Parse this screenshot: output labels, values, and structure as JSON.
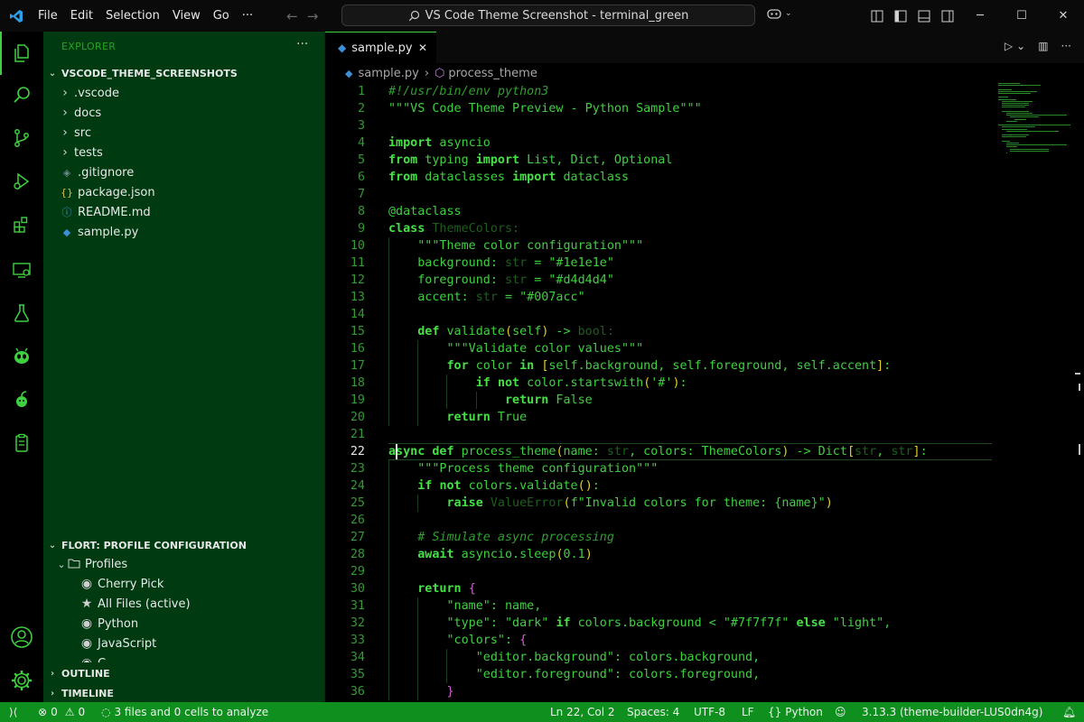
{
  "titlebar": {
    "menus": [
      "File",
      "Edit",
      "Selection",
      "View",
      "Go",
      "···"
    ],
    "command_center": "VS Code Theme Screenshot - terminal_green"
  },
  "explorer": {
    "header": "EXPLORER",
    "more": "···",
    "root": "VSCODE_THEME_SCREENSHOTS",
    "items": [
      {
        "label": ".vscode",
        "kind": "folder"
      },
      {
        "label": "docs",
        "kind": "folder"
      },
      {
        "label": "src",
        "kind": "folder"
      },
      {
        "label": "tests",
        "kind": "folder"
      },
      {
        "label": ".gitignore",
        "kind": "gitignore"
      },
      {
        "label": "package.json",
        "kind": "json"
      },
      {
        "label": "README.md",
        "kind": "info"
      },
      {
        "label": "sample.py",
        "kind": "python"
      }
    ]
  },
  "profiles": {
    "title": "FLORT: PROFILE CONFIGURATION",
    "group": "Profiles",
    "items": [
      {
        "label": "Cherry Pick",
        "icon": "account-icon"
      },
      {
        "label": "All Files (active)",
        "icon": "star-icon"
      },
      {
        "label": "Python",
        "icon": "account-icon"
      },
      {
        "label": "JavaScript",
        "icon": "account-icon"
      },
      {
        "label": "C...",
        "icon": "account-icon"
      }
    ]
  },
  "outline_title": "OUTLINE",
  "timeline_title": "TIMELINE",
  "tab": {
    "label": "sample.py",
    "close": "✕"
  },
  "breadcrumb": {
    "file": "sample.py",
    "symbol": "process_theme"
  },
  "cursor_line": 22,
  "code_lines": [
    "#!/usr/bin/env python3",
    "\"\"\"VS Code Theme Preview - Python Sample\"\"\"",
    "",
    "import asyncio",
    "from typing import List, Dict, Optional",
    "from dataclasses import dataclass",
    "",
    "@dataclass",
    "class ThemeColors:",
    "    \"\"\"Theme color configuration\"\"\"",
    "    background: str = \"#1e1e1e\"",
    "    foreground: str = \"#d4d4d4\"",
    "    accent: str = \"#007acc\"",
    "",
    "    def validate(self) -> bool:",
    "        \"\"\"Validate color values\"\"\"",
    "        for color in [self.background, self.foreground, self.accent]:",
    "            if not color.startswith('#'):",
    "                return False",
    "        return True",
    "",
    "async def process_theme(name: str, colors: ThemeColors) -> Dict[str, str]:",
    "    \"\"\"Process theme configuration\"\"\"",
    "    if not colors.validate():",
    "        raise ValueError(f\"Invalid colors for theme: {name}\")",
    "",
    "    # Simulate async processing",
    "    await asyncio.sleep(0.1)",
    "",
    "    return {",
    "        \"name\": name,",
    "        \"type\": \"dark\" if colors.background < \"#7f7f7f\" else \"light\",",
    "        \"colors\": {",
    "            \"editor.background\": colors.background,",
    "            \"editor.foreground\": colors.foreground,",
    "        }"
  ],
  "statusbar": {
    "errors": "0",
    "warnings": "0",
    "analysis": "3 files and 0 cells to analyze",
    "position": "Ln 22, Col 2",
    "spaces": "Spaces: 4",
    "encoding": "UTF-8",
    "eol": "LF",
    "language": "Python",
    "interpreter": "3.13.3 (theme-builder-LUS0dn4g)"
  },
  "colors": {
    "accent": "#3fd03f",
    "sidebar_bg": "#003a10",
    "status_bg": "#0e8f1e"
  }
}
